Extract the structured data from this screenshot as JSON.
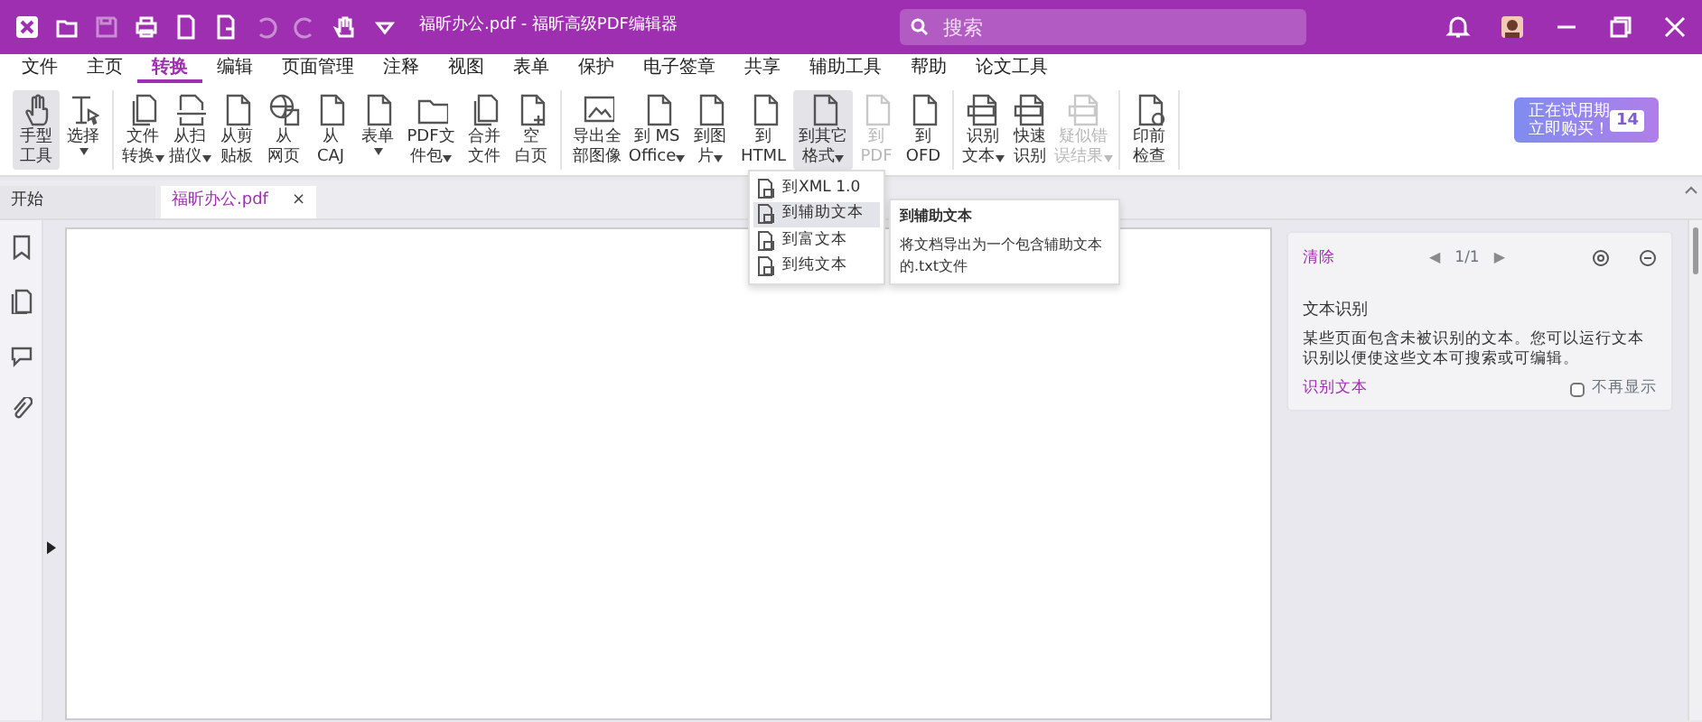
{
  "window": {
    "title": "福昕办公.pdf - 福昕高级PDF编辑器"
  },
  "search": {
    "placeholder": "搜索"
  },
  "menu": [
    {
      "label": "文件",
      "selected": false
    },
    {
      "label": "主页",
      "selected": false
    },
    {
      "label": "转换",
      "selected": true
    },
    {
      "label": "编辑",
      "selected": false
    },
    {
      "label": "页面管理",
      "selected": false
    },
    {
      "label": "注释",
      "selected": false
    },
    {
      "label": "视图",
      "selected": false
    },
    {
      "label": "表单",
      "selected": false
    },
    {
      "label": "保护",
      "selected": false
    },
    {
      "label": "电子签章",
      "selected": false
    },
    {
      "label": "共享",
      "selected": false
    },
    {
      "label": "辅助工具",
      "selected": false
    },
    {
      "label": "帮助",
      "selected": false
    },
    {
      "label": "论文工具",
      "selected": false
    }
  ],
  "ribbon": [
    [
      {
        "lines": [
          "手型",
          "工具"
        ],
        "dropdown": false,
        "selected": true,
        "disabled": false
      },
      {
        "lines": [
          "选择"
        ],
        "dropdown": true,
        "selected": false,
        "disabled": false
      }
    ],
    [
      {
        "lines": [
          "文件",
          "转换"
        ],
        "dropdown": true,
        "selected": false,
        "disabled": false
      },
      {
        "lines": [
          "从扫",
          "描仪"
        ],
        "dropdown": true,
        "selected": false,
        "disabled": false
      },
      {
        "lines": [
          "从剪",
          "贴板"
        ],
        "dropdown": false,
        "selected": false,
        "disabled": false
      },
      {
        "lines": [
          "从",
          "网页"
        ],
        "dropdown": false,
        "selected": false,
        "disabled": false
      },
      {
        "lines": [
          "从",
          "CAJ"
        ],
        "dropdown": false,
        "selected": false,
        "disabled": false
      },
      {
        "lines": [
          "表单"
        ],
        "dropdown": true,
        "selected": false,
        "disabled": false
      },
      {
        "lines": [
          "PDF文",
          "件包"
        ],
        "dropdown": true,
        "selected": false,
        "disabled": false
      },
      {
        "lines": [
          "合并",
          "文件"
        ],
        "dropdown": false,
        "selected": false,
        "disabled": false
      },
      {
        "lines": [
          "空",
          "白页"
        ],
        "dropdown": false,
        "selected": false,
        "disabled": false
      }
    ],
    [
      {
        "lines": [
          "导出全",
          "部图像"
        ],
        "dropdown": false,
        "selected": false,
        "disabled": false
      },
      {
        "lines": [
          "到 MS",
          "Office"
        ],
        "dropdown": true,
        "selected": false,
        "disabled": false
      },
      {
        "lines": [
          "到图",
          "片"
        ],
        "dropdown": true,
        "selected": false,
        "disabled": false
      },
      {
        "lines": [
          "到",
          "HTML"
        ],
        "dropdown": false,
        "selected": false,
        "disabled": false
      },
      {
        "lines": [
          "到其它",
          "格式"
        ],
        "dropdown": true,
        "selected": true,
        "disabled": false
      },
      {
        "lines": [
          "到",
          "PDF"
        ],
        "dropdown": false,
        "selected": false,
        "disabled": true
      },
      {
        "lines": [
          "到",
          "OFD"
        ],
        "dropdown": false,
        "selected": false,
        "disabled": false
      }
    ],
    [
      {
        "lines": [
          "识别",
          "文本"
        ],
        "dropdown": true,
        "selected": false,
        "disabled": false
      },
      {
        "lines": [
          "快速",
          "识别"
        ],
        "dropdown": false,
        "selected": false,
        "disabled": false
      },
      {
        "lines": [
          "疑似错",
          "误结果"
        ],
        "dropdown": true,
        "selected": false,
        "disabled": true
      }
    ],
    [
      {
        "lines": [
          "印前",
          "检查"
        ],
        "dropdown": false,
        "selected": false,
        "disabled": false
      }
    ]
  ],
  "trial": {
    "line1": "正在试用期",
    "line2": "立即购买！",
    "days": "14"
  },
  "doc_tabs": [
    {
      "label": "开始",
      "selected": false,
      "closable": false
    },
    {
      "label": "福昕办公.pdf",
      "selected": true,
      "closable": true
    }
  ],
  "close_glyph": "×",
  "dropdown_menu": [
    {
      "label": "到XML 1.0",
      "selected": false
    },
    {
      "label": "到辅助文本",
      "selected": true
    },
    {
      "label": "到富文本",
      "selected": false
    },
    {
      "label": "到纯文本",
      "selected": false
    }
  ],
  "tooltip": {
    "title": "到辅助文本",
    "text": "将文档导出为一个包含辅助文本的.txt文件"
  },
  "panel": {
    "clear": "清除",
    "prev": "◀",
    "page": "1/1",
    "next": "▶",
    "title": "文本识别",
    "description": "某些页面包含未被识别的文本。您可以运行文本识别以便使这些文本可搜索或可编辑。",
    "action": "识别文本",
    "dont_show": {
      "label": "不再显示",
      "checked": false
    }
  }
}
